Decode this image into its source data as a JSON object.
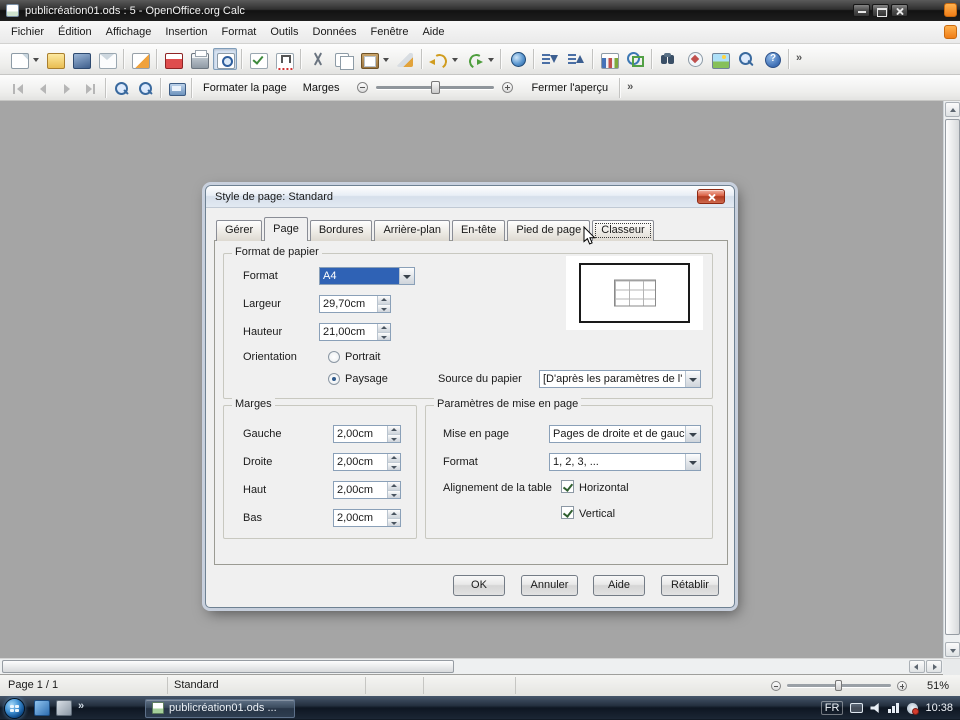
{
  "titlebar": {
    "title": "publicréation01.ods : 5 - OpenOffice.org Calc"
  },
  "menubar": {
    "items": [
      "Fichier",
      "Édition",
      "Affichage",
      "Insertion",
      "Format",
      "Outils",
      "Données",
      "Fenêtre",
      "Aide"
    ]
  },
  "main_toolbar": {
    "icons": [
      "new-document-icon",
      "open-icon",
      "save-icon",
      "document-as-email-icon",
      "edit-file-icon",
      "export-pdf-icon",
      "print-icon",
      "page-preview-icon",
      "spellcheck-icon",
      "autospellcheck-icon",
      "cut-icon",
      "copy-icon",
      "paste-icon",
      "format-paintbrush-icon",
      "undo-icon",
      "redo-icon",
      "hyperlink-icon",
      "sort-ascending-icon",
      "sort-descending-icon",
      "insert-chart-icon",
      "show-draw-functions-icon",
      "find-and-replace-icon",
      "navigator-icon",
      "gallery-icon",
      "zoom-icon",
      "help-icon"
    ],
    "pressed_icon": "page-preview-icon"
  },
  "preview_toolbar": {
    "icons": [
      "first-page-icon",
      "previous-page-icon",
      "next-page-icon",
      "last-page-icon",
      "zoom-in-icon",
      "zoom-out-icon",
      "full-screen-icon"
    ],
    "format_page_label": "Formater la page",
    "margins_label": "Marges",
    "close_preview_label": "Fermer l'aperçu"
  },
  "dialog": {
    "title": "Style de page: Standard",
    "tabs": [
      "Gérer",
      "Page",
      "Bordures",
      "Arrière-plan",
      "En-tête",
      "Pied de page",
      "Classeur"
    ],
    "active_tab": "Page",
    "focused_tab": "Classeur",
    "paper_format": {
      "group_label": "Format de papier",
      "format_label": "Format",
      "format_value": "A4",
      "width_label": "Largeur",
      "width_value": "29,70cm",
      "height_label": "Hauteur",
      "height_value": "21,00cm",
      "orientation_label": "Orientation",
      "portrait_label": "Portrait",
      "portrait_selected": false,
      "landscape_label": "Paysage",
      "landscape_selected": true,
      "paper_source_label": "Source du papier",
      "paper_source_value": "[D'après les paramètres de l'"
    },
    "margins": {
      "group_label": "Marges",
      "left_label": "Gauche",
      "left_value": "2,00cm",
      "right_label": "Droite",
      "right_value": "2,00cm",
      "top_label": "Haut",
      "top_value": "2,00cm",
      "bottom_label": "Bas",
      "bottom_value": "2,00cm"
    },
    "layout_settings": {
      "group_label": "Paramètres de mise en page",
      "page_layout_label": "Mise en page",
      "page_layout_value": "Pages de droite et de gauc",
      "number_format_label": "Format",
      "number_format_value": "1, 2, 3, ...",
      "table_alignment_label": "Alignement de la table",
      "horizontal_label": "Horizontal",
      "horizontal_checked": true,
      "vertical_label": "Vertical",
      "vertical_checked": true
    },
    "buttons": {
      "ok": "OK",
      "cancel": "Annuler",
      "help": "Aide",
      "reset": "Rétablir"
    }
  },
  "statusbar": {
    "page": "Page 1 / 1",
    "style": "Standard",
    "zoom": "51%"
  },
  "taskbar": {
    "task_button_label": "publicréation01.ods ...",
    "language": "FR",
    "clock": "10:38"
  },
  "colors": {
    "selection_blue": "#2f62b5",
    "preview_background": "#a5a5a5",
    "dialog_background": "#f0f0f0",
    "taskbar_dark": "#0e1622"
  }
}
